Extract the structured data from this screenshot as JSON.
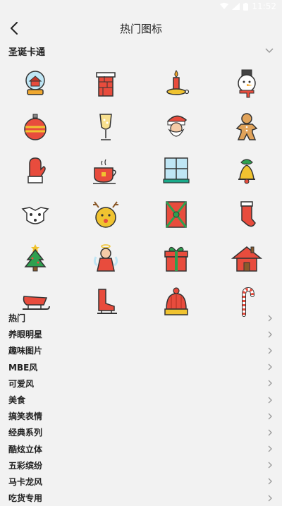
{
  "status": {
    "time": "11:52"
  },
  "header": {
    "title": "热门图标"
  },
  "section": {
    "title": "圣诞卡通"
  },
  "icons": [
    "snow-globe-icon",
    "chimney-icon",
    "candle-icon",
    "snowman-icon",
    "ornament-ball-icon",
    "champagne-glass-icon",
    "santa-claus-icon",
    "gingerbread-man-icon",
    "mitten-icon",
    "tea-cup-icon",
    "window-icon",
    "christmas-bell-icon",
    "reindeer-skull-icon",
    "reindeer-face-icon",
    "gift-card-icon",
    "stocking-icon",
    "christmas-tree-icon",
    "angel-icon",
    "gift-box-icon",
    "house-icon",
    "sleigh-icon",
    "ice-skate-icon",
    "knit-hat-icon",
    "candy-cane-icon"
  ],
  "categories": [
    {
      "label": "热门"
    },
    {
      "label": "养眼明星"
    },
    {
      "label": "趣味图片"
    },
    {
      "label": "MBE风"
    },
    {
      "label": "可爱风"
    },
    {
      "label": "美食"
    },
    {
      "label": "搞笑表情"
    },
    {
      "label": "经典系列"
    },
    {
      "label": "酷炫立体"
    },
    {
      "label": "五彩缤纷"
    },
    {
      "label": "马卡龙风"
    },
    {
      "label": "吃货专用"
    }
  ]
}
